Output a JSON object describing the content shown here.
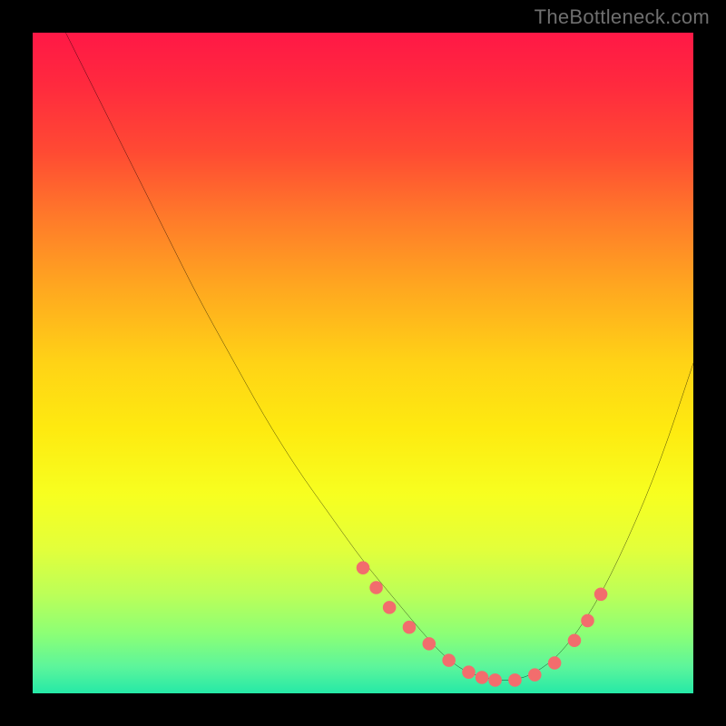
{
  "watermark": "TheBottleneck.com",
  "colors": {
    "frame_bg": "#000000",
    "curve_stroke": "#000000",
    "marker_fill": "#f26d6d",
    "marker_stroke": "#f26d6d"
  },
  "chart_data": {
    "type": "line",
    "title": "",
    "xlabel": "",
    "ylabel": "",
    "xlim": [
      0,
      100
    ],
    "ylim": [
      0,
      100
    ],
    "grid": false,
    "series": [
      {
        "name": "bottleneck-curve",
        "x": [
          5,
          10,
          15,
          20,
          25,
          30,
          35,
          40,
          45,
          50,
          55,
          60,
          63,
          66,
          70,
          73,
          76,
          80,
          85,
          90,
          95,
          100
        ],
        "y": [
          100,
          90,
          80,
          70,
          60,
          51,
          42,
          34,
          27,
          20,
          14,
          8,
          5,
          3,
          2,
          2,
          3,
          6,
          13,
          23,
          35,
          50
        ]
      }
    ],
    "markers": {
      "name": "highlight-dots",
      "x": [
        50,
        52,
        54,
        57,
        60,
        63,
        66,
        68,
        70,
        73,
        76,
        79,
        82,
        84,
        86
      ],
      "y": [
        19,
        16,
        13,
        10,
        7.5,
        5,
        3.2,
        2.4,
        2,
        2,
        2.8,
        4.6,
        8,
        11,
        15
      ]
    }
  }
}
